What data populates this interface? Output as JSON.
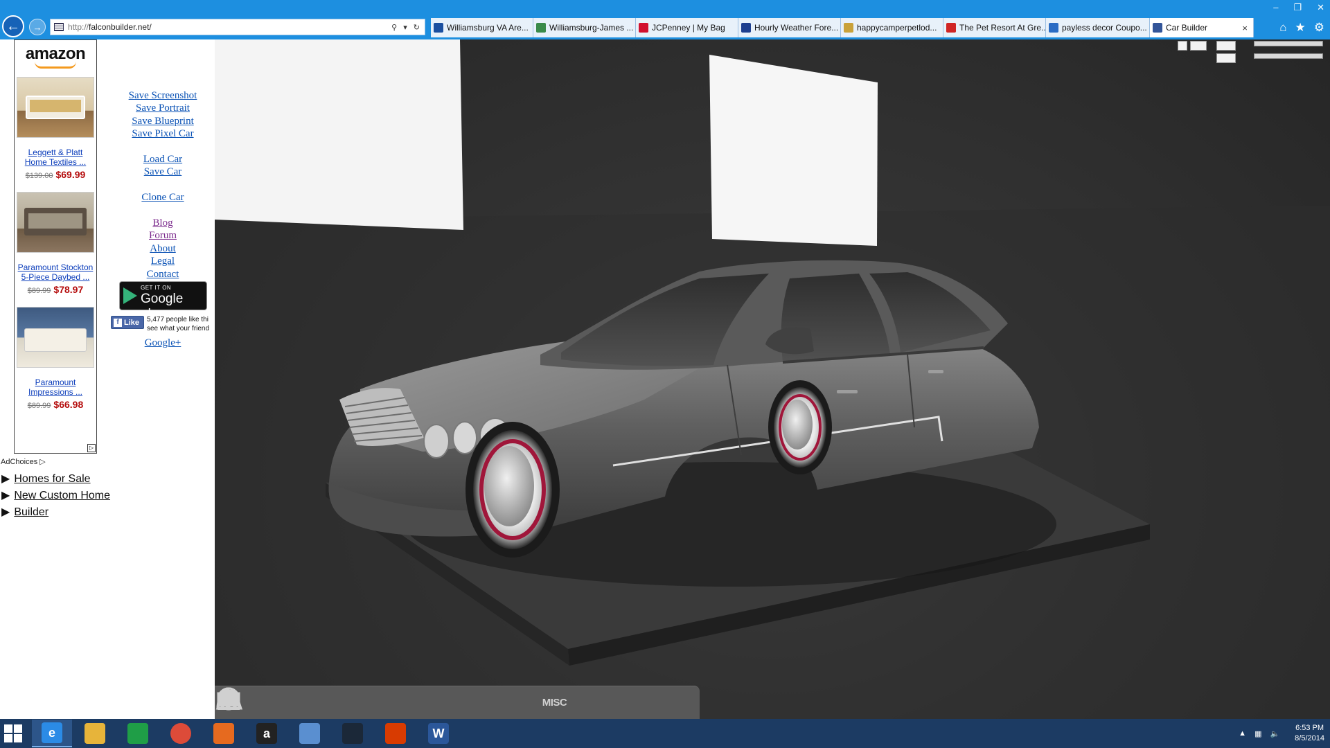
{
  "browser": {
    "url_scheme": "http://",
    "url_host": "falconbuilder.net/",
    "back_icon": "arrow-left-icon",
    "forward_icon": "arrow-right-icon",
    "tabs": [
      {
        "label": "Williamsburg VA Are...",
        "color": "#1a4fa0"
      },
      {
        "label": "Williamsburg-James ...",
        "color": "#3a8b4a"
      },
      {
        "label": "JCPenney | My Bag",
        "color": "#d2102f"
      },
      {
        "label": "Hourly Weather Fore...",
        "color": "#1e3f8f"
      },
      {
        "label": "happycamperpetlod...",
        "color": "#c9a23a"
      },
      {
        "label": "The Pet Resort At Gre...",
        "color": "#d02525"
      },
      {
        "label": "payless decor Coupo...",
        "color": "#2b6cc4"
      },
      {
        "label": "Car Builder",
        "color": "#335599"
      }
    ],
    "active_tab_close": "×",
    "window_controls": [
      "–",
      "❐",
      "✕"
    ],
    "toolbar_icons": [
      "home-icon",
      "star-icon",
      "gear-icon"
    ]
  },
  "ad": {
    "brand": "amazon",
    "items": [
      {
        "title": "Leggett & Platt Home Textiles ...",
        "old_price": "$139.00",
        "price": "$69.99"
      },
      {
        "title": "Paramount Stockton 5-Piece Daybed ...",
        "old_price": "$89.99",
        "price": "$78.97"
      },
      {
        "title": "Paramount Impressions ...",
        "old_price": "$89.99",
        "price": "$66.98"
      }
    ],
    "adchoices": "AdChoices"
  },
  "tree_links": [
    "Homes for Sale",
    "New Custom Home",
    "Builder"
  ],
  "site_nav": {
    "save_screenshot": "Save Screenshot",
    "save_portrait": "Save Portrait",
    "save_blueprint": "Save Blueprint",
    "save_pixel_car": "Save Pixel Car",
    "load_car": "Load Car",
    "save_car": "Save Car",
    "clone_car": "Clone Car",
    "blog": "Blog",
    "forum": "Forum",
    "about": "About",
    "legal": "Legal",
    "contact": "Contact",
    "google_plus": "Google+"
  },
  "google_play": {
    "line1": "GET IT ON",
    "line2": "Google play"
  },
  "facebook": {
    "like_label": "Like",
    "text_line1": "5,477 people like thi",
    "text_line2": "see what your friend"
  },
  "part_toolbar": [
    {
      "name": "body-icon"
    },
    {
      "name": "wheel-icon"
    },
    {
      "name": "paint-icon"
    },
    {
      "name": "suspension-icon"
    },
    {
      "name": "steering-wheel-icon"
    },
    {
      "name": "engine-icon"
    },
    {
      "name": "engine-paint-icon"
    },
    {
      "name": "engine-tune-icon"
    },
    {
      "name": "exhaust-icon"
    },
    {
      "name": "misc-button",
      "label": "MISC"
    },
    {
      "name": "camera-icon"
    },
    {
      "name": "scenery-icon"
    }
  ],
  "taskbar": {
    "apps": [
      "internet-explorer-icon",
      "file-explorer-icon",
      "store-icon",
      "chrome-icon",
      "firefox-icon",
      "amazon-icon",
      "remote-desktop-icon",
      "steam-icon",
      "office-icon",
      "word-icon"
    ],
    "time": "6:53 PM",
    "date": "8/5/2014"
  },
  "colors": {
    "chrome_blue": "#1d8fe0",
    "link_blue": "#0a52b5",
    "link_visited": "#7b2a8c",
    "price_red": "#b40a0a",
    "rim_red": "#a0163a",
    "taskbar": "#1c3b63"
  }
}
